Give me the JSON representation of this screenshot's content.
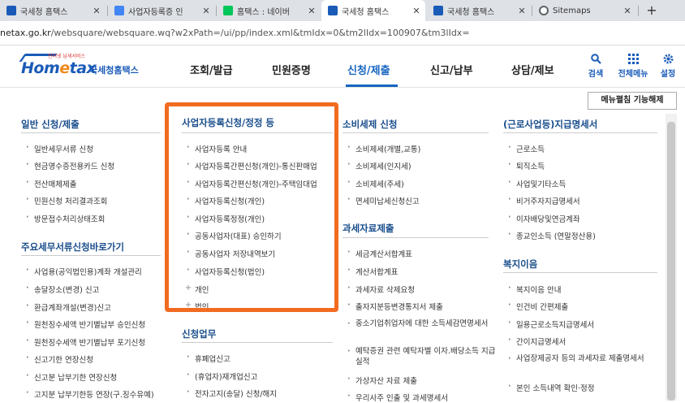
{
  "tabs": [
    {
      "title": "국세청 홈택스",
      "icon": "hometax-favicon",
      "color": "#1a5bb8"
    },
    {
      "title": "사업자등록증 인",
      "icon": "docs-favicon",
      "color": "#4285f4"
    },
    {
      "title": "홈택스 : 네이버",
      "icon": "naver-favicon",
      "color": "#03c75a"
    },
    {
      "title": "국세청 홈택스",
      "icon": "hometax-favicon",
      "color": "#1a5bb8"
    },
    {
      "title": "국세청 홈택스",
      "icon": "hometax-favicon",
      "color": "#1a5bb8"
    },
    {
      "title": "Sitemaps",
      "icon": "globe-favicon",
      "color": "#5f6368"
    }
  ],
  "url": {
    "host": "netax.go.kr",
    "path": "/websquare/websquare.wq?w2xPath=/ui/pp/index.xml&tmIdx=0&tm2lIdx=100907&tm3lIdx="
  },
  "logo": {
    "tagline": "인터넷 납세서비스",
    "home": "Hom",
    "e": "e",
    "tax": "tax",
    "name": "국세청홈택스"
  },
  "menu": [
    "조회/발급",
    "민원증명",
    "신청/제출",
    "신고/납부",
    "상담/제보"
  ],
  "utils": [
    {
      "label": "검색",
      "icon": "search-icon"
    },
    {
      "label": "전체메뉴",
      "icon": "grid-icon"
    },
    {
      "label": "설정",
      "icon": "gear-icon"
    }
  ],
  "reset_button": "메뉴펼침 기능해제",
  "col1": {
    "title1": "일반 신청/제출",
    "items1": [
      "일반세무서류 신청",
      "현금영수증전용카드 신청",
      "전산매체제출",
      "민원신청 처리결과조회",
      "방문접수처리상태조회"
    ],
    "title2": "주요세무서류신청바로가기",
    "items2": [
      "사업용(공익법인용)계좌 개설관리",
      "송달장소(변경) 신고",
      "환급계좌개설(변경)신고",
      "원천징수세액 반기별납부 승인신청",
      "원천징수세액 반기별납부 포기신청",
      "신고기한 연장신청",
      "신고분 납부기한 연장신청",
      "고지분 납부기한등 연장(구.징수유예)"
    ]
  },
  "col2": {
    "title1": "사업자등록신청/정정 등",
    "items1": [
      "사업자등록 안내",
      "사업자등록간편신청(개인)-통신판매업",
      "사업자등록간편신청(개인)-주택임대업",
      "사업자등록신청(개인)",
      "사업자등록정정(개인)",
      "공동사업자(대표) 승인하기",
      "공동사업자 저장내역보기",
      "사업자등록신청(법인)"
    ],
    "plus": [
      "개인",
      "법인"
    ],
    "title2": "신청업무",
    "items2": [
      "휴폐업신고",
      "(휴업자)재개업신고",
      "전자고지(송달) 신청/해지"
    ]
  },
  "col3": {
    "title1": "소비세제 신청",
    "items1": [
      "소비제세(개별,교통)",
      "소비제세(인지세)",
      "소비제세(주세)",
      "면세미납세신청신고"
    ],
    "title2": "과세자료제출",
    "items2": [
      "세금계산서합계표",
      "계산서합계표",
      "과세자료 삭제요청",
      "출자지분등변경통지서 제출",
      "중소기업취업자에 대한 소득세감면명세서",
      "예탁증권 관련 예탁자별 이자.배당소득 지급 실적",
      "가상자산 자료 제출",
      "우리사주 인출 및 과세명세서"
    ]
  },
  "col4": {
    "title1": "(근로사업등)지급명세서",
    "items1": [
      "근로소득",
      "퇴직소득",
      "사업및기타소득",
      "비거주자지급명세서",
      "이자배당및연금계좌",
      "종교인소득 (연말정산용)"
    ],
    "title2": "복지이음",
    "items2": [
      "복지이음 안내",
      "인건비 간편제출",
      "일용근로소득지급명세서",
      "간이지급명세서",
      "사업장제공자 등의 과세자료 제출명세서",
      "본인 소득내역 확인·정정"
    ]
  }
}
